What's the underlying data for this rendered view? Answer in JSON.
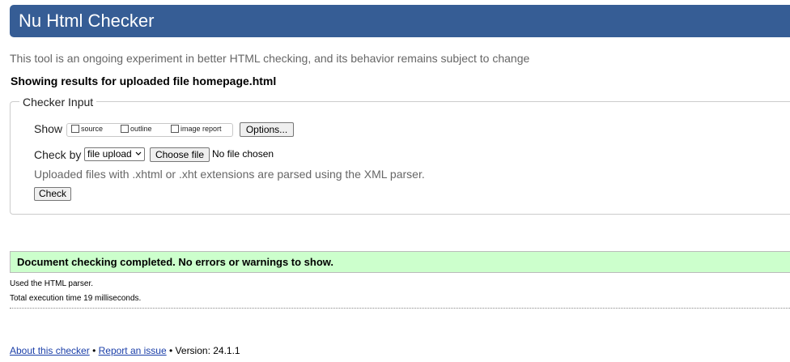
{
  "header": {
    "title": "Nu Html Checker"
  },
  "intro": "This tool is an ongoing experiment in better HTML checking, and its behavior remains subject to change",
  "results_heading": "Showing results for uploaded file homepage.html",
  "checker_input": {
    "legend": "Checker Input",
    "show_label": "Show",
    "show_options": [
      {
        "label": "source",
        "checked": false
      },
      {
        "label": "outline",
        "checked": false
      },
      {
        "label": "image report",
        "checked": false
      }
    ],
    "options_button": "Options...",
    "check_by_label": "Check by",
    "check_by_value": "file upload",
    "choose_file_button": "Choose file",
    "no_file_text": "No file chosen",
    "hint": "Uploaded files with .xhtml or .xht extensions are parsed using the XML parser.",
    "check_button": "Check"
  },
  "result": {
    "message": "Document checking completed. No errors or warnings to show.",
    "parser_text": "Used the HTML parser.",
    "time_text": "Total execution time 19 milliseconds."
  },
  "footer": {
    "about_link": "About this checker",
    "separator": "•",
    "report_link": "Report an issue",
    "version_text": "Version: 24.1.1"
  },
  "colors": {
    "header_bg": "#365d95",
    "success_bg": "#ccffcc",
    "link": "#1a3ea8"
  }
}
